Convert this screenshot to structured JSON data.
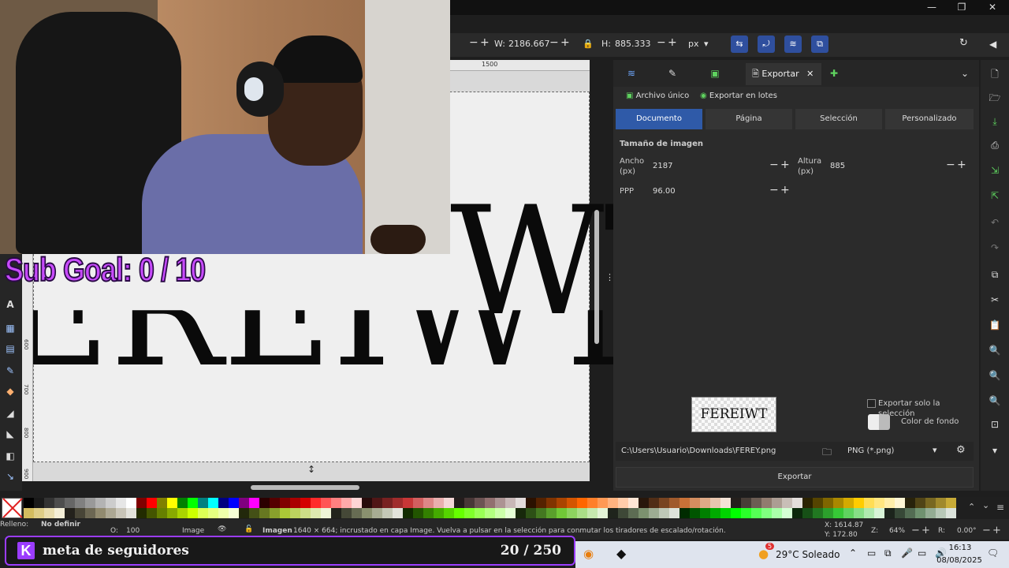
{
  "toolbar": {
    "w_label": "W:",
    "w_value": "2186.667",
    "h_label": "H:",
    "h_value": "885.333",
    "unit": "px"
  },
  "ruler": {
    "top_mark": "1500",
    "left_marks": [
      "500",
      "600",
      "700",
      "800",
      "900"
    ]
  },
  "canvas_text": {
    "top": "WT",
    "bottom": "EREIWT"
  },
  "overlay": {
    "sub_goal": "Sub Goal: 0 / 10",
    "meta_label": "meta de seguidores",
    "meta_count": "20 / 250"
  },
  "export_panel": {
    "tab_label": "Exportar",
    "mode_single": "Archivo único",
    "mode_batch": "Exportar en lotes",
    "segments": [
      "Documento",
      "Página",
      "Selección",
      "Personalizado"
    ],
    "active_segment": "Documento",
    "section_title": "Tamaño de imagen",
    "width_label": "Ancho (px)",
    "width_value": "2187",
    "height_label": "Altura (px)",
    "height_value": "885",
    "dpi_label": "PPP",
    "dpi_value": "96.00",
    "preview_text": "FEREIWT",
    "only_selection": "Exportar solo la selección",
    "bg_color": "Color de fondo",
    "path": "C:\\Users\\Usuario\\Downloads\\FEREY.png",
    "format": "PNG (*.png)",
    "export_button": "Exportar"
  },
  "statusbar": {
    "fill_label": "Relleno:",
    "fill_value": "No definir",
    "opacity_label": "O:",
    "opacity_value": "100",
    "layer": "Image",
    "message_bold": "Imagen",
    "message": "1640 × 664; incrustado en capa Image. Vuelva a pulsar en la selección para conmutar los tiradores de escalado/rotación.",
    "x": "X: 1614.87",
    "y": "Y: 172.80",
    "zoom_label": "Z:",
    "zoom_value": "64%",
    "rot_label": "R:",
    "rot_value": "0.00°"
  },
  "taskbar": {
    "weather_badge": "5",
    "weather": "29°C  Soleado",
    "time": "16:13",
    "date": "08/08/2025"
  },
  "colors": {
    "accent": "#2f5aa8",
    "overlay_purple": "#9b3cff",
    "palette": [
      "#000000",
      "#1a1a1a",
      "#333333",
      "#4d4d4d",
      "#666666",
      "#808080",
      "#999999",
      "#b3b3b3",
      "#cccccc",
      "#e6e6e6",
      "#ffffff",
      "#800000",
      "#ff0000",
      "#808000",
      "#ffff00",
      "#008000",
      "#00ff00",
      "#008080",
      "#00ffff",
      "#000080",
      "#0000ff",
      "#800080",
      "#ff00ff",
      "#2b0000",
      "#550000",
      "#800000",
      "#aa0000",
      "#d40000",
      "#ff2a2a",
      "#ff5555",
      "#ff8080",
      "#ffaaaa",
      "#ffd5d5",
      "#280b0b",
      "#501616",
      "#782121",
      "#a02c2c",
      "#c83737",
      "#d35f5f",
      "#de8787",
      "#e9afaf",
      "#f4d7d7",
      "#241c1c",
      "#483737",
      "#6c5353",
      "#916f6f",
      "#ac9393",
      "#c8b7b7",
      "#e3dbdb",
      "#2b1100",
      "#552200",
      "#803300",
      "#aa4400",
      "#d45500",
      "#ff6600",
      "#ff7f2a",
      "#ff9955",
      "#ffb380",
      "#ffccaa",
      "#ffe6d5",
      "#28170b",
      "#502d16",
      "#784421",
      "#a05a2c",
      "#c87137",
      "#d38d5f",
      "#deaa87",
      "#e9c6af",
      "#f4e3d7",
      "#241f1c",
      "#483e37",
      "#6c5d53",
      "#917c6f",
      "#ac9d93",
      "#c8beb7",
      "#e3dedb",
      "#2b2200",
      "#554400",
      "#806600",
      "#aa8800",
      "#d4aa00",
      "#ffcc00",
      "#ffdd55",
      "#ffe680",
      "#ffeeaa",
      "#fff6d5",
      "#28220b",
      "#504416",
      "#786721",
      "#a0892c",
      "#c8ab37",
      "#d3bc5f",
      "#decd87",
      "#e9ddaf",
      "#f4eed7",
      "#24221c",
      "#484537",
      "#6c6753",
      "#918a6f",
      "#aca793",
      "#c8c4b7",
      "#e3e2db",
      "#222b00",
      "#445500",
      "#668000",
      "#88aa00",
      "#aad400",
      "#ccff00",
      "#ddff55",
      "#e5ff80",
      "#eeffaa",
      "#f6ffd5",
      "#22280b",
      "#445016",
      "#677821",
      "#89a02c",
      "#abc837",
      "#bcd35f",
      "#cdde87",
      "#dde9af",
      "#eef4d7",
      "#22241c",
      "#454837",
      "#676c53",
      "#8a916f",
      "#a7ac93",
      "#c4c8b7",
      "#e2e3db",
      "#112b00",
      "#225500",
      "#338000",
      "#44aa00",
      "#55d400",
      "#66ff00",
      "#7fff2a",
      "#99ff55",
      "#b3ff80",
      "#ccffaa",
      "#e5ffd5",
      "#17280b",
      "#2d5016",
      "#447821",
      "#5aa02c",
      "#71c837",
      "#8dd35f",
      "#aade87",
      "#c6e9af",
      "#e3f4d7",
      "#1f241c",
      "#3e4837",
      "#5d6c53",
      "#7c916f",
      "#9dac93",
      "#bec8b7",
      "#dee3db",
      "#002b00",
      "#005500",
      "#008000",
      "#00aa00",
      "#00d400",
      "#00ff00",
      "#2aff2a",
      "#55ff55",
      "#80ff80",
      "#aaffaa",
      "#d5ffd5",
      "#0b280b",
      "#165016",
      "#217821",
      "#2ca02c",
      "#37c837",
      "#5fd35f",
      "#87de87",
      "#afe9af",
      "#d7f4d7",
      "#1c241c",
      "#374837",
      "#536c53",
      "#6f916f",
      "#93ac93",
      "#b7c8b7",
      "#dbe3db"
    ]
  }
}
